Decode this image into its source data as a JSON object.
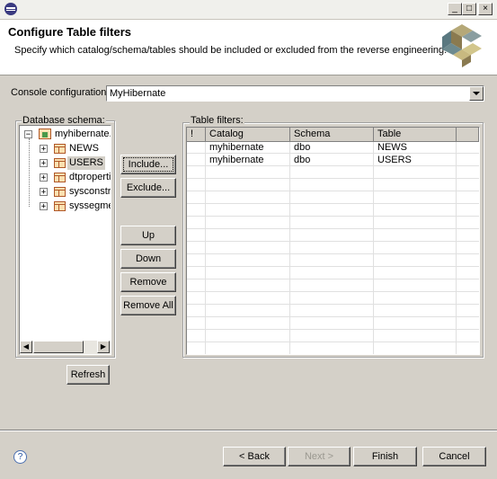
{
  "window": {
    "minimize_glyph": "_",
    "restore_glyph": "□",
    "close_glyph": "×"
  },
  "header": {
    "title": "Configure Table filters",
    "description": "Specify which catalog/schema/tables should be included or excluded from the reverse engineering."
  },
  "console": {
    "label": "Console configuration:",
    "value": "MyHibernate"
  },
  "schema": {
    "group_label": "Database schema:",
    "root": "myhibernate.dbo",
    "items": [
      {
        "label": "NEWS",
        "selected": false
      },
      {
        "label": "USERS",
        "selected": true
      },
      {
        "label": "dtproperties",
        "selected": false
      },
      {
        "label": "sysconstraints",
        "selected": false
      },
      {
        "label": "syssegments",
        "selected": false
      }
    ],
    "refresh_label": "Refresh"
  },
  "actions": {
    "include": "Include...",
    "exclude": "Exclude...",
    "up": "Up",
    "down": "Down",
    "remove": "Remove",
    "remove_all": "Remove All"
  },
  "filters": {
    "group_label": "Table filters:",
    "columns": [
      "!",
      "Catalog",
      "Schema",
      "Table"
    ],
    "rows": [
      {
        "flag": "",
        "catalog": "myhibernate",
        "schema": "dbo",
        "table": "NEWS"
      },
      {
        "flag": "",
        "catalog": "myhibernate",
        "schema": "dbo",
        "table": "USERS"
      }
    ]
  },
  "footer": {
    "help_glyph": "?",
    "back": "< Back",
    "next": "Next >",
    "finish": "Finish",
    "cancel": "Cancel"
  },
  "icons": {
    "app": "eclipse-icon",
    "banner": "hibernate-logo",
    "table": "table-icon",
    "help": "help-icon"
  }
}
